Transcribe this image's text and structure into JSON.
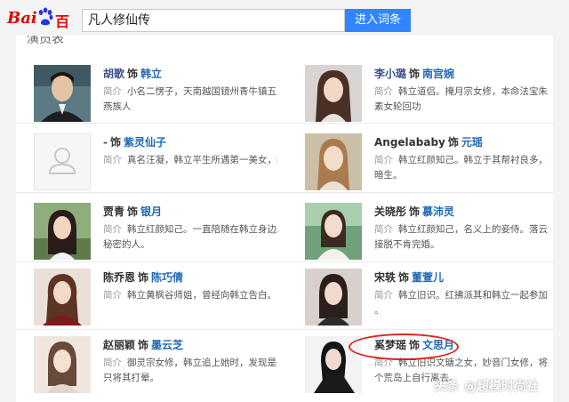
{
  "search": {
    "query": "凡人修仙传",
    "button_label": "进入词条"
  },
  "logo": {
    "text_bai": "Bai",
    "text_baike": "百科"
  },
  "section": {
    "title": "演员表"
  },
  "cast": [
    {
      "actor": "胡歌",
      "sep": "饰",
      "role": "韩立",
      "label": "简介",
      "desc1": "小名二愣子，天南越国镜州青牛镇五里沟人氏，",
      "desc2": "燕族人"
    },
    {
      "actor": "李小璐",
      "sep": "饰",
      "role": "南宫婉",
      "label": "简介",
      "desc1": "韩立道侣。掩月宗女修，本命法宝朱雀环，修炼",
      "desc2": "素女轮回功"
    },
    {
      "actor": "-",
      "sep": "饰",
      "role": "紫灵仙子",
      "label": "简介",
      "desc1": "真名汪凝，韩立平生所遇第一美女，红颜知己。",
      "desc2": ""
    },
    {
      "actor": "Angelababy",
      "sep": "饰",
      "role": "元瑶",
      "label": "简介",
      "desc1": "韩立红颜知己。韩立于其帮衬良多，对韩立情素",
      "desc2": "暗生。"
    },
    {
      "actor": "贾青",
      "sep": "饰",
      "role": "银月",
      "label": "简介",
      "desc1": "韩立红颜知己。一直陪随在韩立身边。知晓韩立",
      "desc2": "秘密的人。"
    },
    {
      "actor": "关晓彤",
      "sep": "饰",
      "role": "慕沛灵",
      "label": "简介",
      "desc1": "韩立红颜知己，名义上的妾侍。落云宗女修，直",
      "desc2": "接脱不肯完婚。"
    },
    {
      "actor": "陈乔恩",
      "sep": "饰",
      "role": "陈巧倩",
      "label": "简介",
      "desc1": "韩立黄枫谷师姐，曾经向韩立告白。",
      "desc2": ""
    },
    {
      "actor": "宋轶",
      "sep": "饰",
      "role": "董萱儿",
      "label": "简介",
      "desc1": "韩立旧识。红拂派其和韩立一起参加落霞夺宝大会",
      "desc2": "。"
    },
    {
      "actor": "赵丽颖",
      "sep": "饰",
      "role": "墨云芝",
      "label": "简介",
      "desc1": "御灵宗女修，韩立追上她时，发现是多年前旧识",
      "desc2": "只将其打晕。"
    },
    {
      "actor": "奚梦瑶",
      "sep": "饰",
      "role": "文思月",
      "label": "简介",
      "desc1": "韩立旧识文瑭之女，妙音门女修，将她安置在一",
      "desc2": "个荒岛上自行离去。"
    }
  ],
  "watermark": {
    "brand": "头条",
    "account": "@超模时尚社"
  },
  "colors": {
    "search_button": "#3385ff",
    "link_role": "#1f68b5",
    "logo_red": "#e10602",
    "highlight_circle": "#d7261f"
  }
}
